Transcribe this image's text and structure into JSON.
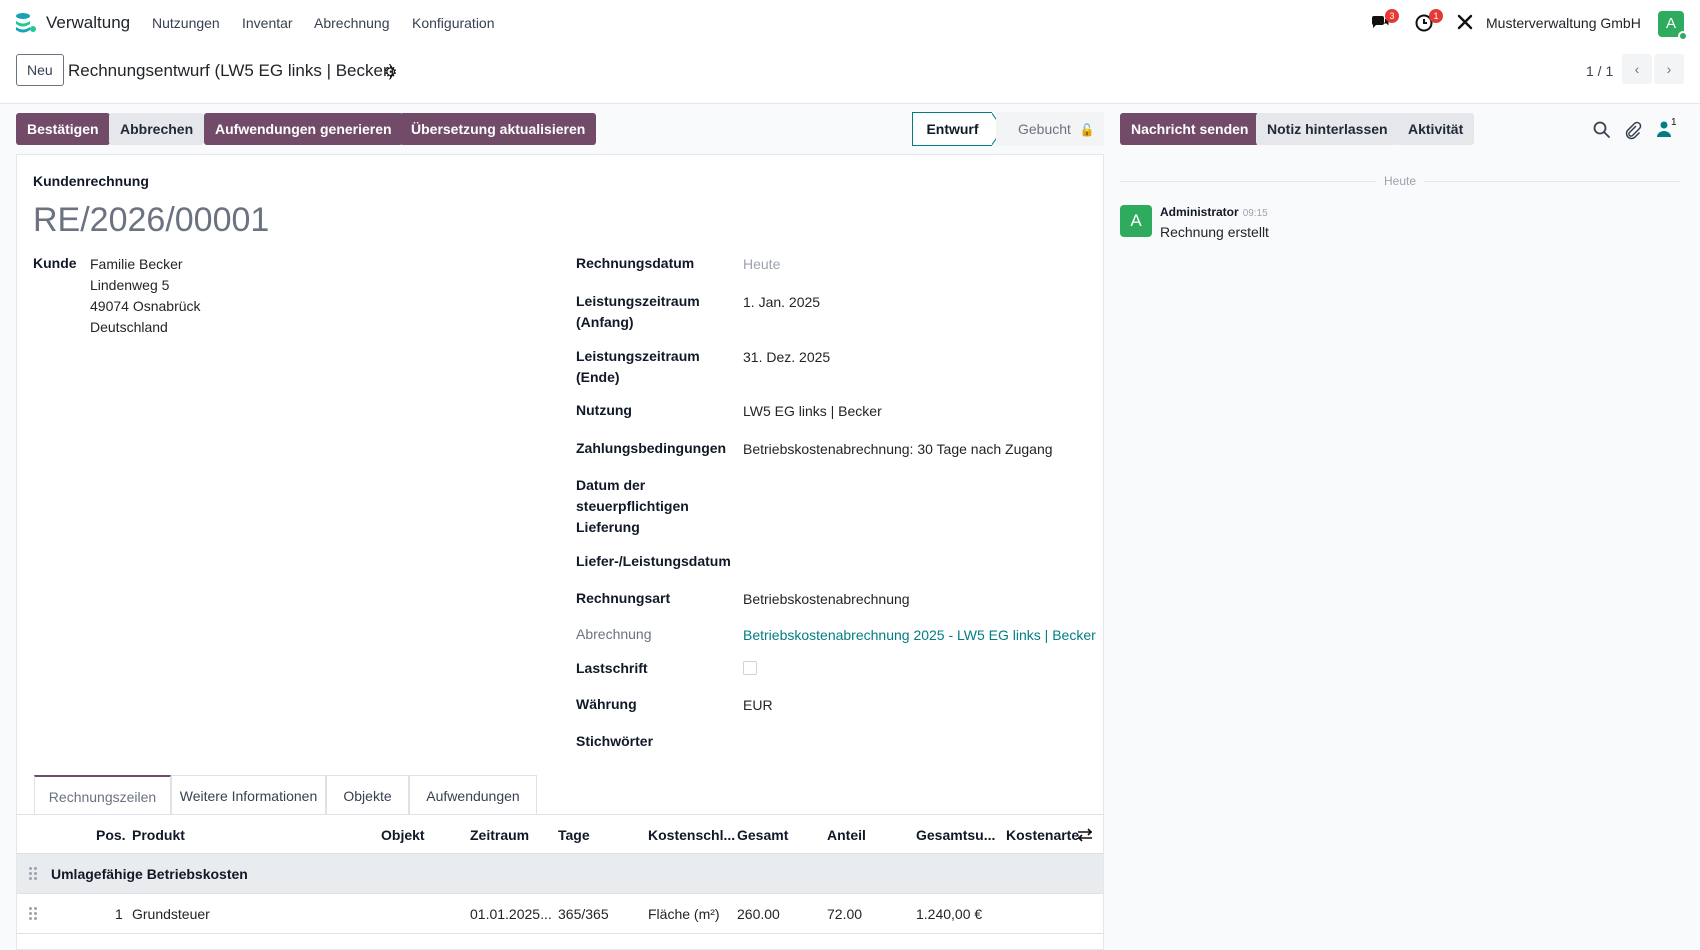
{
  "navbar": {
    "brand": "Verwaltung",
    "menu": [
      "Nutzungen",
      "Inventar",
      "Abrechnung",
      "Konfiguration"
    ],
    "messages_badge": "3",
    "activities_badge": "1",
    "company": "Musterverwaltung GmbH",
    "user_initial": "A"
  },
  "breadcrumb": {
    "new_label": "Neu",
    "title": "Rechnungsentwurf (LW5 EG links | Becker)",
    "pager": "1 / 1"
  },
  "actions": {
    "confirm": "Bestätigen",
    "cancel": "Abbrechen",
    "generate": "Aufwendungen generieren",
    "translate": "Übersetzung aktualisieren"
  },
  "status": {
    "active": "Entwurf",
    "next": "Gebucht"
  },
  "chatter": {
    "send_message": "Nachricht senden",
    "log_note": "Notiz hinterlassen",
    "activity": "Aktivität",
    "followers_count": "1",
    "today": "Heute",
    "author_initial": "A",
    "author": "Administrator",
    "time": "09:15",
    "message": "Rechnung erstellt"
  },
  "form": {
    "type_label": "Kundenrechnung",
    "number": "RE/2026/00001",
    "customer_label": "Kunde",
    "customer_lines": [
      "Familie Becker",
      "Lindenweg 5",
      "49074 Osnabrück",
      "Deutschland"
    ],
    "fields": {
      "invoice_date": {
        "label": "Rechnungsdatum",
        "value": "Heute"
      },
      "period_start": {
        "label_1": "Leistungszeitraum",
        "label_2": "(Anfang)",
        "value": "1. Jan. 2025"
      },
      "period_end": {
        "label_1": "Leistungszeitraum",
        "label_2": "(Ende)",
        "value": "31. Dez. 2025"
      },
      "usage": {
        "label": "Nutzung",
        "value": "LW5 EG links | Becker"
      },
      "payment_terms": {
        "label": "Zahlungsbedingungen",
        "value": "Betriebskostenabrechnung: 30 Tage nach Zugang"
      },
      "taxable_supply": {
        "label_1": "Datum der",
        "label_2": "steuerpflichtigen",
        "label_3": "Lieferung",
        "value": ""
      },
      "delivery_date": {
        "label": "Liefer-/Leistungsdatum",
        "value": ""
      },
      "invoice_kind": {
        "label": "Rechnungsart",
        "value": "Betriebskostenabrechnung"
      },
      "settlement": {
        "label": "Abrechnung",
        "value": "Betriebskostenabrechnung 2025 - LW5 EG links | Becker"
      },
      "direct_debit": {
        "label": "Lastschrift",
        "checked": false
      },
      "currency": {
        "label": "Währung",
        "value": "EUR"
      },
      "tags": {
        "label": "Stichwörter",
        "value": ""
      }
    }
  },
  "tabs": [
    "Rechnungszeilen",
    "Weitere Informationen",
    "Objekte",
    "Aufwendungen"
  ],
  "table": {
    "columns": [
      "Pos.",
      "Produkt",
      "Objekt",
      "Zeitraum",
      "Tage",
      "Kostenschl...",
      "Gesamt",
      "Anteil",
      "Gesamtsu...",
      "Kostenarte"
    ],
    "section": "Umlagefähige Betriebskosten",
    "rows": [
      {
        "pos": "1",
        "product": "Grundsteuer",
        "object": "",
        "period": "01.01.2025...",
        "days": "365/365",
        "key": "Fläche (m²)",
        "total": "260.00",
        "share": "72.00",
        "sum": "1.240,00 €",
        "cost_type": ""
      }
    ]
  }
}
